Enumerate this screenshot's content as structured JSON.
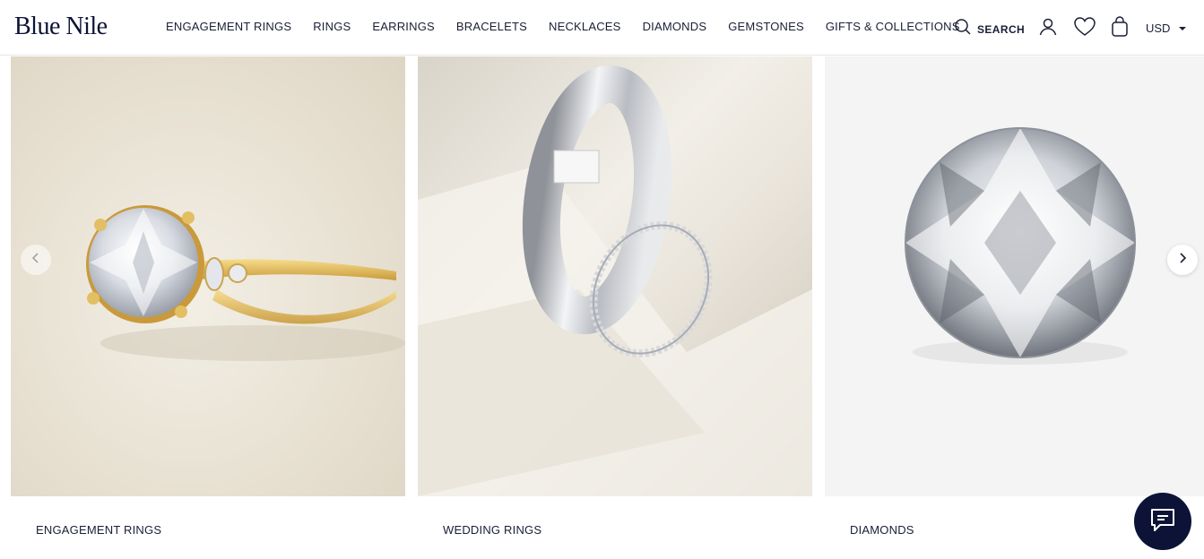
{
  "header": {
    "logo": "Blue Nile",
    "nav": [
      "ENGAGEMENT RINGS",
      "RINGS",
      "EARRINGS",
      "BRACELETS",
      "NECKLACES",
      "DIAMONDS",
      "GEMSTONES",
      "GIFTS & COLLECTIONS"
    ],
    "search_label": "SEARCH",
    "currency": "USD",
    "icons": [
      "search-icon",
      "account-icon",
      "wishlist-heart-icon",
      "shopping-bag-icon",
      "chevron-down-icon"
    ]
  },
  "carousel": {
    "cards": [
      {
        "label": "ENGAGEMENT RINGS",
        "image": "gold solitaire engagement ring with round diamond"
      },
      {
        "label": "WEDDING RINGS",
        "image": "platinum wedding band and diamond eternity band"
      },
      {
        "label": "DIAMONDS",
        "image": "round brilliant loose diamond"
      }
    ],
    "icons": [
      "chevron-left-icon",
      "chevron-right-icon"
    ]
  },
  "chat": {
    "icon": "chat-bubble-icon"
  },
  "colors": {
    "brand_navy": "#0d1337",
    "text": "#1a1f36"
  }
}
